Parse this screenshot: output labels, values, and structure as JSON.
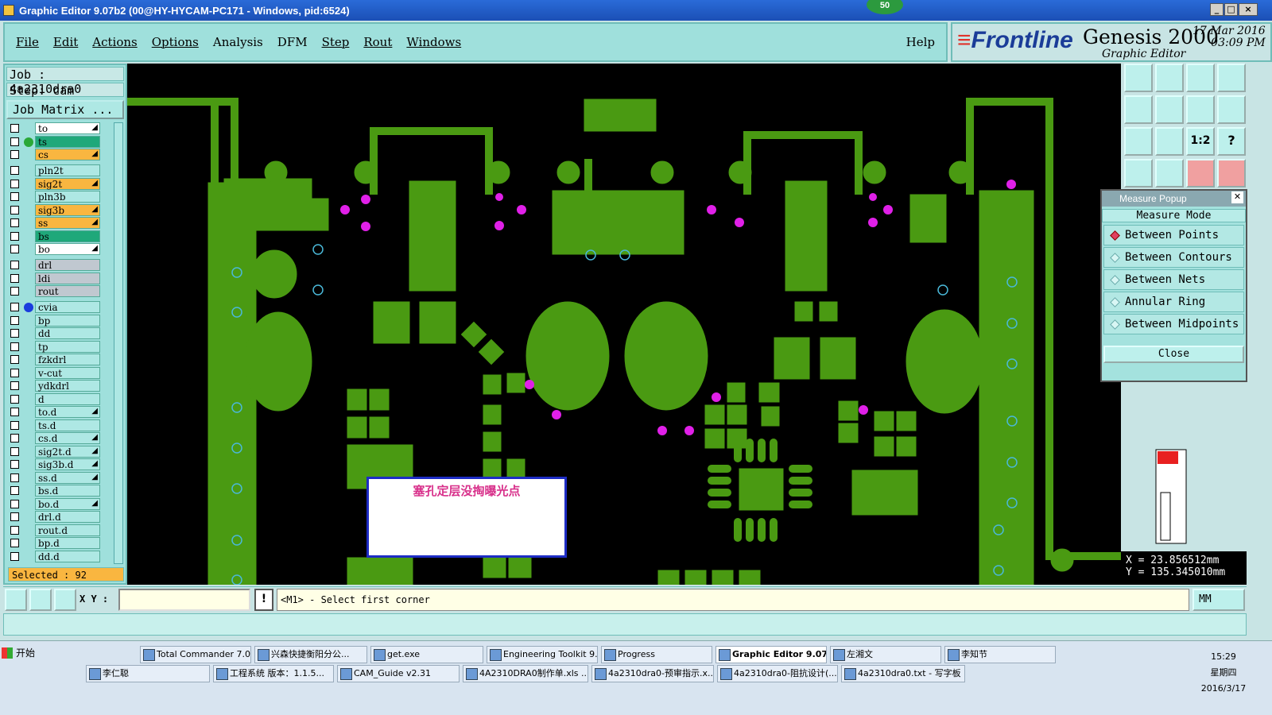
{
  "window": {
    "title": "Graphic Editor 9.07b2 (00@HY-HYCAM-PC171 - Windows, pid:6524)",
    "badge": "50"
  },
  "menus": [
    "File",
    "Edit",
    "Actions",
    "Options",
    "Analysis",
    "DFM",
    "Step",
    "Rout",
    "Windows"
  ],
  "help": "Help",
  "brand": {
    "logo": "Frontline",
    "product": "Genesis 2000",
    "subtitle": "Graphic Editor",
    "date": "17 Mar 2016",
    "time": "03:09 PM"
  },
  "job": {
    "job_line": "Job : 4a2310dra0",
    "step_line": "Step: cam",
    "matrix_button": "Job Matrix ..."
  },
  "layers": [
    {
      "name": "to",
      "color": "#ffffff",
      "dot": "",
      "arrow": true
    },
    {
      "name": "ts",
      "color": "#1fa87a",
      "dot": "#2aa838",
      "arrow": false
    },
    {
      "name": "cs",
      "color": "#f9b640",
      "dot": "",
      "arrow": true
    },
    {
      "name": "pln2t",
      "color": "#aee8e4",
      "dot": "",
      "arrow": false
    },
    {
      "name": "sig2t",
      "color": "#f9b640",
      "dot": "",
      "arrow": true
    },
    {
      "name": "pln3b",
      "color": "#aee8e4",
      "dot": "",
      "arrow": false
    },
    {
      "name": "sig3b",
      "color": "#f9b640",
      "dot": "",
      "arrow": true
    },
    {
      "name": "ss",
      "color": "#f9b640",
      "dot": "",
      "arrow": true
    },
    {
      "name": "bs",
      "color": "#1fa87a",
      "dot": "",
      "arrow": false
    },
    {
      "name": "bo",
      "color": "#ffffff",
      "dot": "",
      "arrow": true
    },
    {
      "name": "drl",
      "color": "#c0c8d0",
      "dot": "",
      "arrow": false
    },
    {
      "name": "ldi",
      "color": "#c0c8d0",
      "dot": "",
      "arrow": false
    },
    {
      "name": "rout",
      "color": "#c0c8d0",
      "dot": "",
      "arrow": false
    },
    {
      "name": "cvia",
      "color": "#aee8e4",
      "dot": "#1a3cdd",
      "arrow": false
    },
    {
      "name": "bp",
      "color": "#aee8e4",
      "dot": "",
      "arrow": false
    },
    {
      "name": "dd",
      "color": "#aee8e4",
      "dot": "",
      "arrow": false
    },
    {
      "name": "tp",
      "color": "#aee8e4",
      "dot": "",
      "arrow": false
    },
    {
      "name": "fzkdrl",
      "color": "#aee8e4",
      "dot": "",
      "arrow": false
    },
    {
      "name": "v-cut",
      "color": "#aee8e4",
      "dot": "",
      "arrow": false
    },
    {
      "name": "ydkdrl",
      "color": "#aee8e4",
      "dot": "",
      "arrow": false
    },
    {
      "name": "d",
      "color": "#aee8e4",
      "dot": "",
      "arrow": false
    },
    {
      "name": "to.d",
      "color": "#aee8e4",
      "dot": "",
      "arrow": true
    },
    {
      "name": "ts.d",
      "color": "#aee8e4",
      "dot": "",
      "arrow": false
    },
    {
      "name": "cs.d",
      "color": "#aee8e4",
      "dot": "",
      "arrow": true
    },
    {
      "name": "sig2t.d",
      "color": "#aee8e4",
      "dot": "",
      "arrow": true
    },
    {
      "name": "sig3b.d",
      "color": "#aee8e4",
      "dot": "",
      "arrow": true
    },
    {
      "name": "ss.d",
      "color": "#aee8e4",
      "dot": "",
      "arrow": true
    },
    {
      "name": "bs.d",
      "color": "#aee8e4",
      "dot": "",
      "arrow": false
    },
    {
      "name": "bo.d",
      "color": "#aee8e4",
      "dot": "",
      "arrow": true
    },
    {
      "name": "drl.d",
      "color": "#aee8e4",
      "dot": "",
      "arrow": false
    },
    {
      "name": "rout.d",
      "color": "#aee8e4",
      "dot": "",
      "arrow": false
    },
    {
      "name": "bp.d",
      "color": "#aee8e4",
      "dot": "",
      "arrow": false
    },
    {
      "name": "dd.d",
      "color": "#aee8e4",
      "dot": "",
      "arrow": false
    }
  ],
  "selected": "Selected : 92",
  "canvas": {
    "note": "塞孔定层没掏曝光点"
  },
  "measure": {
    "title": "Measure Popup",
    "mode_label": "Measure Mode",
    "options": [
      "Between Points",
      "Between Contours",
      "Between Nets",
      "Annular Ring",
      "Between Midpoints"
    ],
    "selected_option": "Between Points",
    "close": "Close"
  },
  "coords": {
    "x_line": "X = 23.856512mm",
    "y_line": "Y = 135.345010mm"
  },
  "bottom": {
    "xy_label": "X Y :",
    "xy_value": "",
    "info": "!",
    "status": "<M1> - Select first corner",
    "units": "MM"
  },
  "taskbar": {
    "start": "开始",
    "row1": [
      "Total Commander 7.0 ...",
      "兴森快捷衡阳分公...",
      "get.exe",
      "Engineering Toolkit 9....",
      "Progress",
      "Graphic Editor 9.07...",
      "左湘文",
      "李知节"
    ],
    "row2": [
      "李仁聪",
      "工程系统 版本：1.1.5...",
      "CAM_Guide v2.31",
      "4A2310DRA0制作单.xls ...",
      "4a2310dra0-预审指示.x...",
      "4a2310dra0-阻抗设计(...",
      "4a2310dra0.txt - 写字板"
    ],
    "time": "15:29",
    "weekday": "星期四",
    "date": "2016/3/17"
  },
  "colors": {
    "copper": "#4a9a12",
    "pad_magenta": "#e020e8",
    "via_ring": "#4ab8d8"
  }
}
